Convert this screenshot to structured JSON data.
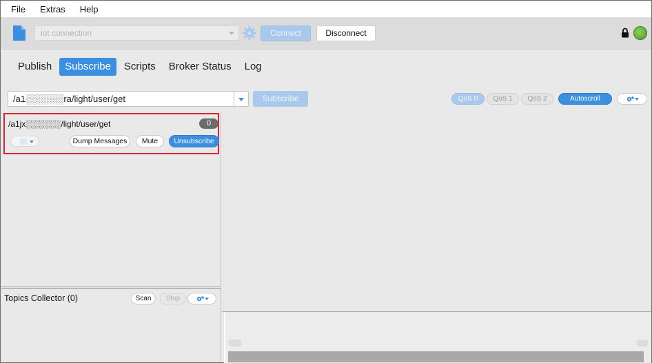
{
  "menu": {
    "items": [
      "File",
      "Extras",
      "Help"
    ]
  },
  "toolbar": {
    "connection_profile": "iot connection",
    "connect_label": "Connect",
    "disconnect_label": "Disconnect",
    "status": "connected",
    "status_color": "#5aa832"
  },
  "tabs": {
    "items": [
      "Publish",
      "Subscribe",
      "Scripts",
      "Broker Status",
      "Log"
    ],
    "active": "Subscribe"
  },
  "subscribe": {
    "topic_value": "/a1░░░░░░ra/light/user/get",
    "subscribe_label": "Subscribe",
    "qos0_label": "QoS 0",
    "qos1_label": "QoS 1",
    "qos2_label": "QoS 2",
    "autoscroll_label": "Autoscroll"
  },
  "subscription": {
    "topic": "/a1jx░░░░░░/light/user/get",
    "message_count": "0",
    "dump_label": "Dump Messages",
    "mute_label": "Mute",
    "unsubscribe_label": "Unsubscribe"
  },
  "collector": {
    "title": "Topics Collector (0)",
    "scan_label": "Scan",
    "stop_label": "Stop"
  },
  "colors": {
    "accent": "#3b8fe0",
    "highlight_border": "#d9232d"
  }
}
